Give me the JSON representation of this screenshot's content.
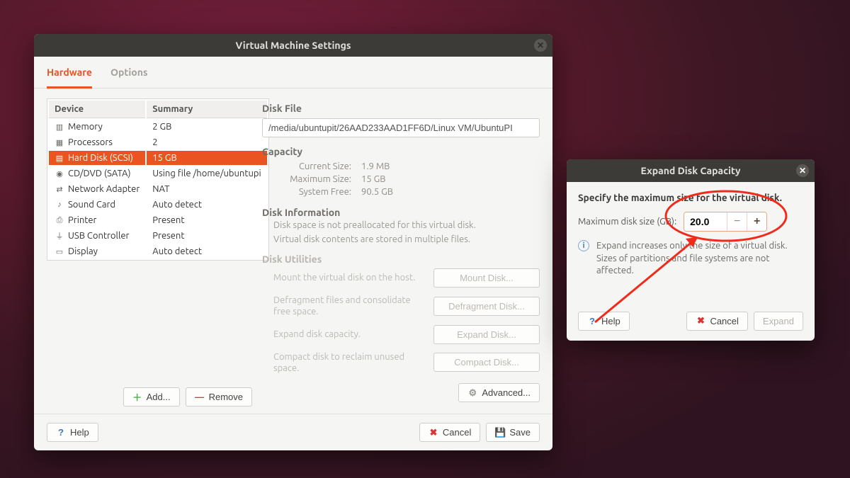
{
  "settings": {
    "title": "Virtual Machine Settings",
    "tabs": {
      "hardware": "Hardware",
      "options": "Options"
    },
    "table": {
      "headers": {
        "device": "Device",
        "summary": "Summary"
      },
      "rows": [
        {
          "icon": "memory-icon",
          "device": "Memory",
          "summary": "2 GB"
        },
        {
          "icon": "cpu-icon",
          "device": "Processors",
          "summary": "2"
        },
        {
          "icon": "hdd-icon",
          "device": "Hard Disk (SCSI)",
          "summary": "15 GB",
          "selected": true
        },
        {
          "icon": "cd-icon",
          "device": "CD/DVD (SATA)",
          "summary": "Using file /home/ubuntupi"
        },
        {
          "icon": "net-icon",
          "device": "Network Adapter",
          "summary": "NAT"
        },
        {
          "icon": "sound-icon",
          "device": "Sound Card",
          "summary": "Auto detect"
        },
        {
          "icon": "printer-icon",
          "device": "Printer",
          "summary": "Present"
        },
        {
          "icon": "usb-icon",
          "device": "USB Controller",
          "summary": "Present"
        },
        {
          "icon": "display-icon",
          "device": "Display",
          "summary": "Auto detect"
        }
      ]
    },
    "add": "Add...",
    "remove": "Remove",
    "disk_file_label": "Disk File",
    "disk_file_value": "/media/ubuntupit/26AAD233AAD1FF6D/Linux VM/UbuntuPI",
    "capacity_label": "Capacity",
    "capacity": {
      "current_k": "Current Size:",
      "current_v": "1.9 MB",
      "max_k": "Maximum Size:",
      "max_v": "15 GB",
      "free_k": "System Free:",
      "free_v": "90.5 GB"
    },
    "disk_info_label": "Disk Information",
    "disk_info_1": "Disk space is not preallocated for this virtual disk.",
    "disk_info_2": "Virtual disk contents are stored in multiple files.",
    "disk_util_label": "Disk Utilities",
    "utils": {
      "mount_d": "Mount the virtual disk on the host.",
      "mount_b": "Mount Disk...",
      "defrag_d": "Defragment files and consolidate free space.",
      "defrag_b": "Defragment Disk...",
      "expand_d": "Expand disk capacity.",
      "expand_b": "Expand Disk...",
      "compact_d": "Compact disk to reclaim unused space.",
      "compact_b": "Compact Disk..."
    },
    "advanced": "Advanced...",
    "help": "Help",
    "cancel": "Cancel",
    "save": "Save"
  },
  "expand": {
    "title": "Expand Disk Capacity",
    "specify": "Specify the maximum size for the virtual disk.",
    "max_label": "Maximum disk size (GB):",
    "value": "20.0",
    "note": "Expand increases only the size of a virtual disk. Sizes of partitions and file systems are not affected.",
    "help": "Help",
    "cancel": "Cancel",
    "expand_btn": "Expand"
  }
}
